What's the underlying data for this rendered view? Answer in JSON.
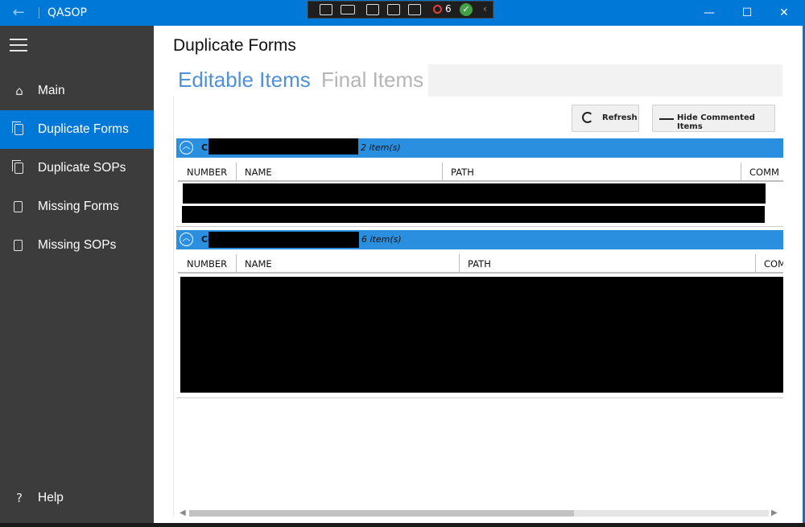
{
  "window": {
    "app_title": "QASOP",
    "back_icon": "arrow-left-icon"
  },
  "debug_toolbar": {
    "badge_count": "6"
  },
  "window_controls": {
    "minimize": "—",
    "maximize": "☐",
    "close": "✕"
  },
  "sidebar": {
    "items": [
      {
        "label": "Main",
        "icon": "home-icon"
      },
      {
        "label": "Duplicate Forms",
        "icon": "copy-page-icon",
        "active": true
      },
      {
        "label": "Duplicate SOPs",
        "icon": "copy-page-icon"
      },
      {
        "label": "Missing Forms",
        "icon": "page-icon"
      },
      {
        "label": "Missing SOPs",
        "icon": "page-icon"
      }
    ],
    "help": {
      "label": "Help",
      "icon": "question-icon"
    }
  },
  "main": {
    "page_title": "Duplicate Forms",
    "tabs": [
      {
        "label": "Editable Items",
        "active": true
      },
      {
        "label": "Final Items",
        "active": false
      }
    ],
    "actions": {
      "refresh_label": "Refresh",
      "hide_label": "Hide Commented Items"
    },
    "groups": [
      {
        "prefix": "Ch",
        "count": "2 item(s)",
        "columns": [
          "NUMBER",
          "NAME",
          "PATH",
          "COMM"
        ]
      },
      {
        "prefix": "Co",
        "count": "6 item(s)",
        "columns": [
          "NUMBER",
          "NAME",
          "PATH",
          "COM"
        ]
      }
    ]
  },
  "colors": {
    "accent": "#0078d7",
    "group_header": "#2b8fe0",
    "sidebar_bg": "#3c3c3c",
    "tab_active": "#4f90d6",
    "tab_inactive": "#b5b5b5"
  }
}
